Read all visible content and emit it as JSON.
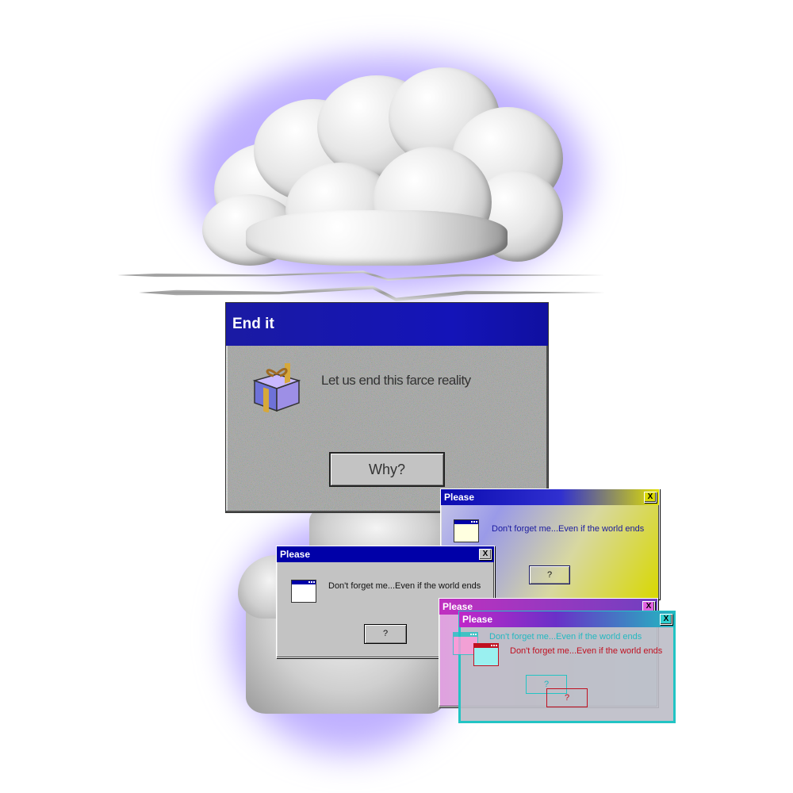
{
  "windows": {
    "end_it": {
      "title": "End it",
      "message": "Let us end this farce reality",
      "button": "Why?",
      "icon": "gift-box-icon"
    },
    "please_yellow": {
      "title": "Please",
      "message": "Don't forget me...Even if the world ends",
      "button": "?",
      "close": "X"
    },
    "please_gray": {
      "title": "Please",
      "message": "Don't forget me...Even if the world ends",
      "button": "?",
      "close": "X"
    },
    "please_magenta": {
      "title": "Please",
      "close": "X"
    },
    "please_cyan": {
      "title": "Please",
      "message": "Don't forget me...Even if the world ends",
      "message_shadow": "Don't forget me...Even if the world ends",
      "button": "?",
      "button_shadow": "?",
      "close": "X"
    }
  },
  "colors": {
    "titlebar_blue": "#0000a8",
    "glow": "#aa96ff",
    "yellow_gradient_end": "#d8d800",
    "magenta": "#cc33cc",
    "cyan": "#22c4c4"
  }
}
